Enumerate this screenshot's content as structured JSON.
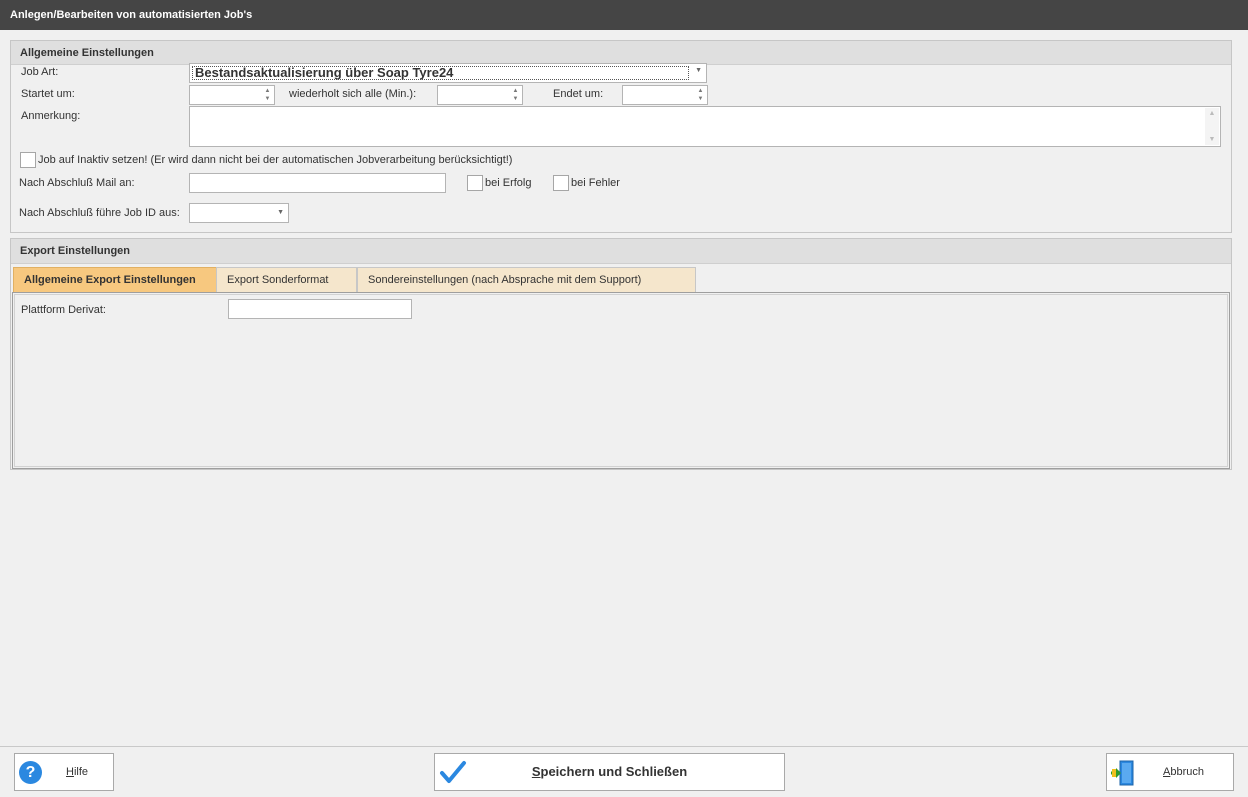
{
  "window": {
    "title": "Anlegen/Bearbeiten von automatisierten Job's"
  },
  "general": {
    "header": "Allgemeine Einstellungen",
    "job_art_label": "Job Art:",
    "job_art_value": "Bestandsaktualisierung über Soap Tyre24",
    "start_label": "Startet um:",
    "repeat_label": "wiederholt sich alle (Min.):",
    "end_label": "Endet um:",
    "note_label": "Anmerkung:",
    "inactive_label": "Job auf Inaktiv setzen! (Er wird dann nicht bei der automatischen Jobverarbeitung berücksichtigt!)",
    "mail_label": "Nach Abschluß Mail an:",
    "success_label": "bei Erfolg",
    "error_label": "bei Fehler",
    "followup_label": "Nach Abschluß führe Job ID aus:"
  },
  "export": {
    "header": "Export Einstellungen",
    "tabs": [
      {
        "label": "Allgemeine Export Einstellungen",
        "active": true
      },
      {
        "label": "Export Sonderformat",
        "active": false
      },
      {
        "label": "Sondereinstellungen (nach Absprache mit dem Support)",
        "active": false
      }
    ],
    "platform_label": "Plattform Derivat:"
  },
  "footer": {
    "help_label": "Hilfe",
    "help_accesskey": "H",
    "help_rest": "ilfe",
    "save_accesskey": "S",
    "save_rest": "peichern und Schließen",
    "cancel_accesskey": "A",
    "cancel_rest": "bbruch"
  },
  "colors": {
    "titlebar": "#454545",
    "active_tab": "#f7c87f",
    "inactive_tab": "#f5e6cc",
    "accent_blue": "#2b88e0"
  },
  "icons": {
    "help": "question-mark-circle",
    "save": "checkmark",
    "cancel": "exit-door"
  }
}
